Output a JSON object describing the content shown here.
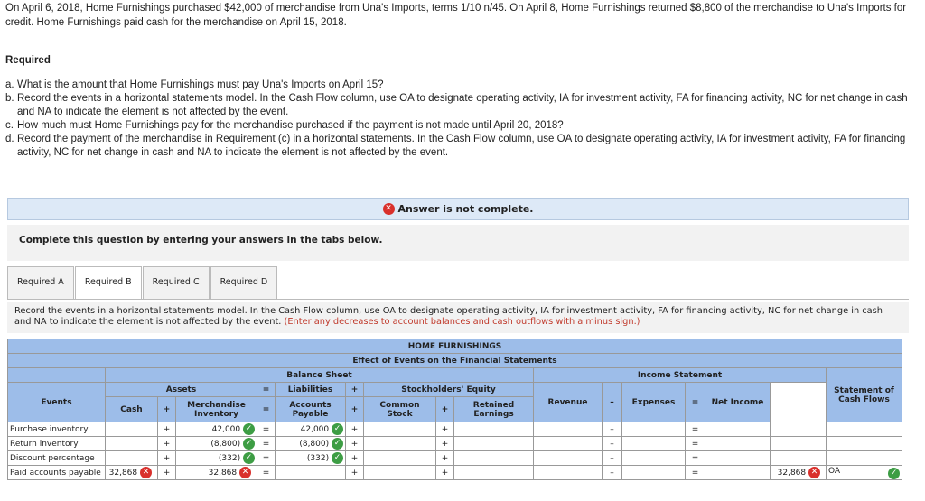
{
  "intro": "On April 6, 2018, Home Furnishings purchased $42,000 of merchandise from Una's Imports, terms 1/10 n/45. On April 8, Home Furnishings returned $8,800 of the merchandise to Una's Imports for credit. Home Furnishings paid cash for the merchandise on April 15, 2018.",
  "required_title": "Required",
  "questions": [
    {
      "letter": "a.",
      "text": "What is the amount that Home Furnishings must pay Una's Imports on April 15?"
    },
    {
      "letter": "b.",
      "text": "Record the events in a horizontal statements model. In the Cash Flow column, use OA to designate operating activity, IA for investment activity, FA for financing activity, NC for net change in cash and NA to indicate the element is not affected by the event."
    },
    {
      "letter": "c.",
      "text": "How much must Home Furnishings pay for the merchandise purchased if the payment is not made until April 20, 2018?"
    },
    {
      "letter": "d.",
      "text": "Record the payment of the merchandise in Requirement (c) in a horizontal statements. In the Cash Flow column, use OA to designate operating activity, IA for investment activity, FA for financing activity, NC for net change in cash and NA to indicate the element is not affected by the event."
    }
  ],
  "banner": {
    "text": "Answer is not complete.",
    "icon": "x-circle-icon",
    "color": "#d9302c"
  },
  "complete_text": "Complete this question by entering your answers in the tabs below.",
  "tabs": [
    "Required A",
    "Required B",
    "Required C",
    "Required D"
  ],
  "active_tab": "Required B",
  "instructions": {
    "main": "Record the events in a horizontal statements model. In the Cash Flow column, use OA to designate operating activity, IA for investment activity, FA for financing activity, NC for net change in cash and NA to indicate the element is not affected by the event.",
    "note": "(Enter any decreases to account balances and cash outflows with a minus sign.)"
  },
  "table": {
    "company": "HOME FURNISHINGS",
    "subtitle": "Effect of Events on the Financial Statements",
    "balance_sheet": "Balance Sheet",
    "income_statement": "Income Statement",
    "events_header": "Events",
    "assets": "Assets",
    "liabilities": "Liabilities",
    "stockholders_equity": "Stockholders' Equity",
    "cash": "Cash",
    "merchandise_inventory": "Merchandise Inventory",
    "accounts_payable": "Accounts Payable",
    "common_stock": "Common Stock",
    "retained_earnings": "Retained Earnings",
    "revenue": "Revenue",
    "expenses": "Expenses",
    "net_income": "Net Income",
    "cash_flows": "Statement of Cash Flows",
    "op_plus": "+",
    "op_eq": "=",
    "op_minus": "–",
    "rows": [
      {
        "event": "Purchase inventory",
        "cash": "",
        "merch": "42,000",
        "ap": "42,000",
        "cf_amount": "",
        "cf_act": ""
      },
      {
        "event": "Return inventory",
        "cash": "",
        "merch": "(8,800)",
        "ap": "(8,800)",
        "cf_amount": "",
        "cf_act": ""
      },
      {
        "event": "Discount percentage",
        "cash": "",
        "merch": "(332)",
        "ap": "(332)",
        "cf_amount": "",
        "cf_act": ""
      },
      {
        "event": "Paid accounts payable",
        "cash": "32,868",
        "merch": "32,868",
        "ap": "",
        "cf_amount": "32,868",
        "cf_act": "OA"
      }
    ]
  },
  "colors": {
    "header_blue": "#9dbde9",
    "correct_green": "#3d9d44",
    "wrong_red": "#d9302c",
    "banner_bg": "#dde9f7",
    "note_red": "#c0392b"
  }
}
